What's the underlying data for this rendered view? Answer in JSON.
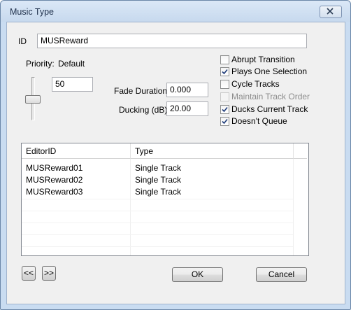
{
  "window": {
    "title": "Music Type"
  },
  "form": {
    "id_label": "ID",
    "id_value": "MUSReward",
    "priority_label": "Priority:",
    "priority_default": "Default",
    "priority_value": "50",
    "fade_label": "Fade Duration:",
    "fade_value": "0.000",
    "ducking_label": "Ducking (dB):",
    "ducking_value": "20.00"
  },
  "options": [
    {
      "label": "Abrupt Transition",
      "checked": false,
      "enabled": true
    },
    {
      "label": "Plays One Selection",
      "checked": true,
      "enabled": true
    },
    {
      "label": "Cycle Tracks",
      "checked": false,
      "enabled": true
    },
    {
      "label": "Maintain Track Order",
      "checked": false,
      "enabled": false
    },
    {
      "label": "Ducks Current Track",
      "checked": true,
      "enabled": true
    },
    {
      "label": "Doesn't Queue",
      "checked": true,
      "enabled": true
    }
  ],
  "tracks": {
    "columns": [
      "EditorID",
      "Type"
    ],
    "rows": [
      {
        "editor_id": "MUSReward01",
        "type": "Single Track"
      },
      {
        "editor_id": "MUSReward02",
        "type": "Single Track"
      },
      {
        "editor_id": "MUSReward03",
        "type": "Single Track"
      }
    ]
  },
  "buttons": {
    "prev": "<<",
    "next": ">>",
    "ok": "OK",
    "cancel": "Cancel"
  }
}
